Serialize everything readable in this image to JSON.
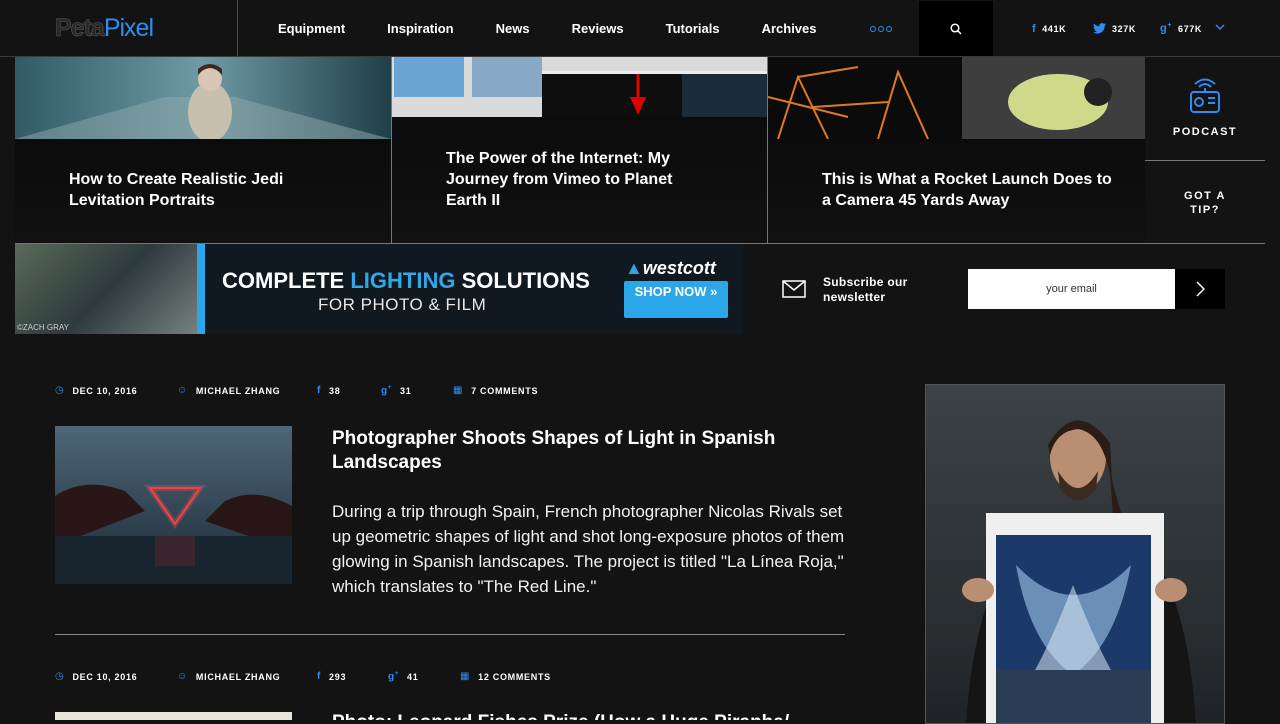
{
  "header": {
    "logo_peta": "Peta",
    "logo_pixel": "Pixel",
    "nav": [
      "Equipment",
      "Inspiration",
      "News",
      "Reviews",
      "Tutorials",
      "Archives"
    ],
    "more_icon": "more-dots-icon",
    "search_icon": "search-icon",
    "social": {
      "facebook": "441K",
      "twitter": "327K",
      "googleplus": "677K"
    }
  },
  "featured": [
    {
      "title": "How to Create Realistic Jedi Levitation Portraits"
    },
    {
      "title": "The Power of the Internet: My Journey from Vimeo to Planet Earth II"
    },
    {
      "title": "This is What a Rocket Launch Does to a Camera 45 Yards Away"
    }
  ],
  "side": {
    "podcast": "PODCAST",
    "tip": "GOT A TIP?"
  },
  "ad": {
    "headline_a": "COMPLETE ",
    "headline_b": "LIGHTING",
    "headline_c": " SOLUTIONS",
    "sub": "FOR PHOTO & FILM",
    "brand": "westcott",
    "shop": "SHOP NOW »",
    "credit": "©ZACH GRAY"
  },
  "newsletter": {
    "label": "Subscribe our newsletter",
    "placeholder": "your email"
  },
  "articles": [
    {
      "date": "DEC 10, 2016",
      "author": "MICHAEL ZHANG",
      "fb": "38",
      "gplus": "31",
      "comments": "7 COMMENTS",
      "title": "Photographer Shoots Shapes of Light in Spanish Landscapes",
      "excerpt": "During a trip through Spain, French photographer Nicolas Rivals set up geometric shapes of light and shot long-exposure photos of them glowing in Spanish landscapes. The project is titled \"La Línea Roja,\" which translates to \"The Red Line.\""
    },
    {
      "date": "DEC 10, 2016",
      "author": "MICHAEL ZHANG",
      "fb": "293",
      "gplus": "41",
      "comments": "12 COMMENTS",
      "title": "Photo: Leopard Fishes Prize (How a Huge Piranha/..."
    }
  ],
  "colors": {
    "accent": "#2f8cf0",
    "background": "#131313"
  }
}
